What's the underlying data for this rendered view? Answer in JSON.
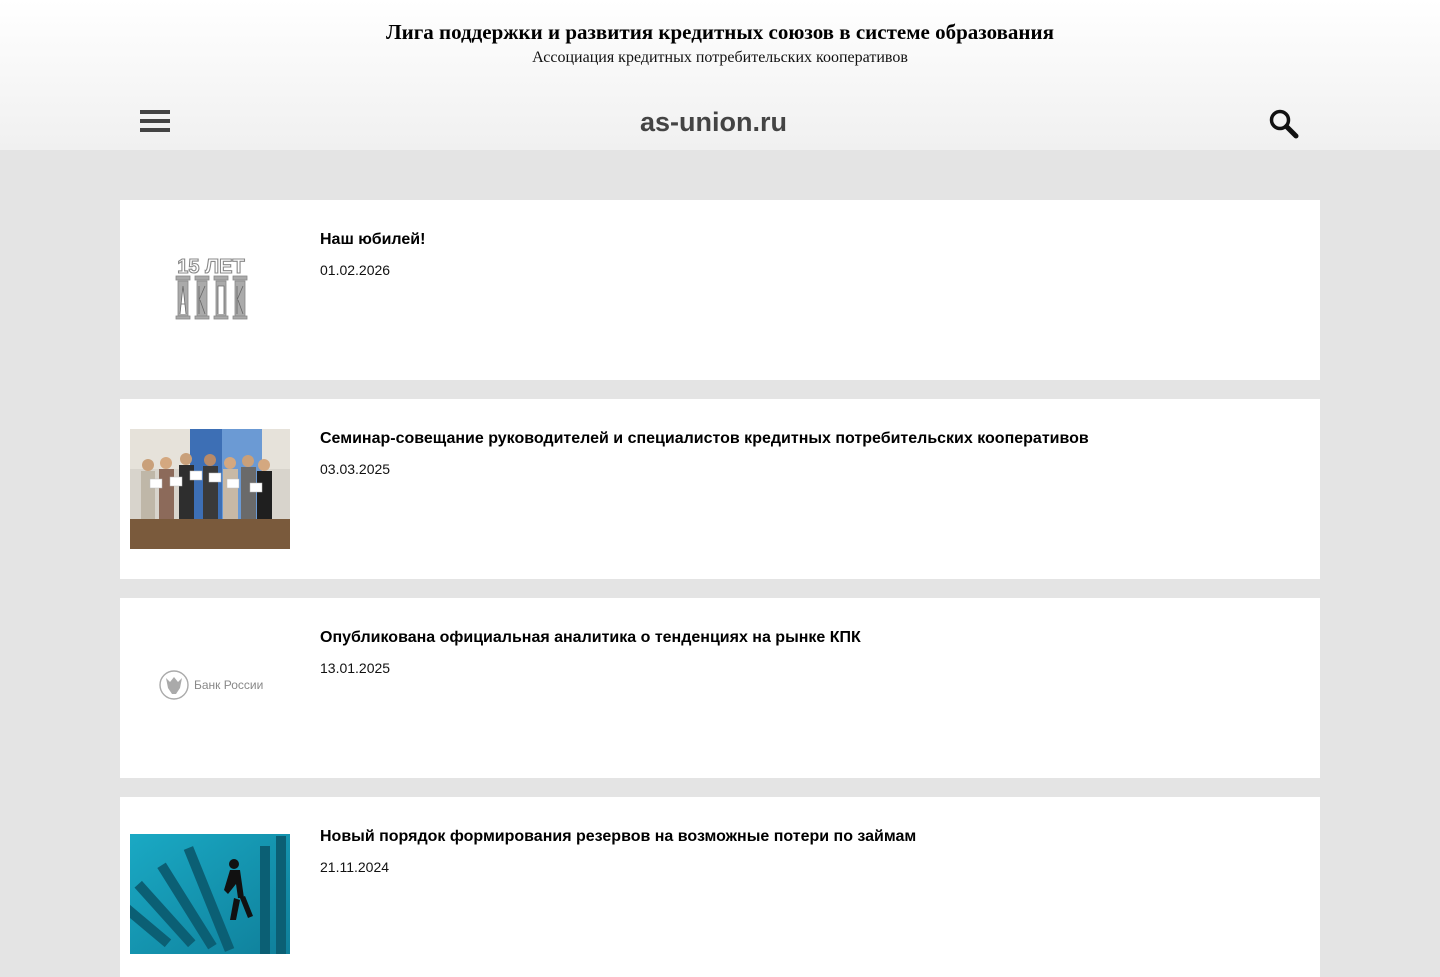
{
  "header": {
    "title": "Лига поддержки и развития кредитных союзов в системе образования",
    "subtitle": "Ассоциация кредитных потребительских кооперативов",
    "domain": "as-union.ru",
    "menu_icon": "hamburger-icon",
    "search_icon": "search-icon"
  },
  "logos": {
    "akpk": "15 ЛЕТ",
    "cbr": "Банк России"
  },
  "news": [
    {
      "title": "Наш юбилей!",
      "date": "01.02.2026",
      "thumb": "akpk-15-years-logo"
    },
    {
      "title": "Семинар-совещание руководителей и специалистов кредитных потребительских кооперативов",
      "date": "03.03.2025",
      "thumb": "seminar-group-photo"
    },
    {
      "title": "Опубликована официальная аналитика о тенденциях на рынке КПК",
      "date": "13.01.2025",
      "thumb": "bank-of-russia-logo"
    },
    {
      "title": "Новый порядок формирования резервов на возможные потери по займам",
      "date": "21.11.2024",
      "thumb": "dominoes-illustration"
    }
  ]
}
